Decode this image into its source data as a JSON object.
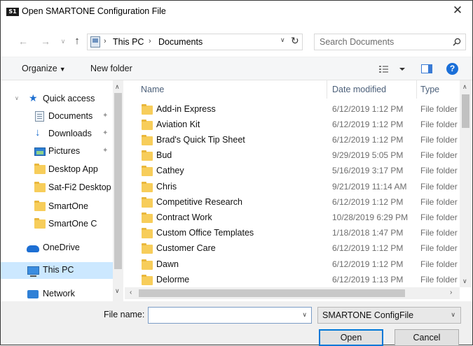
{
  "window": {
    "app_icon": "S1",
    "title": "Open SMARTONE Configuration File",
    "close_glyph": "✕"
  },
  "address": {
    "crumbs": [
      "This PC",
      "Documents"
    ],
    "search_placeholder": "Search Documents"
  },
  "toolbar": {
    "organize": "Organize",
    "new_folder": "New folder",
    "help_glyph": "?"
  },
  "navpane": {
    "items": [
      {
        "label": "Quick access",
        "icon": "star-icon",
        "pinned": false
      },
      {
        "label": "Documents",
        "icon": "document-icon",
        "pinned": true
      },
      {
        "label": "Downloads",
        "icon": "download-icon",
        "pinned": true
      },
      {
        "label": "Pictures",
        "icon": "pictures-icon",
        "pinned": true
      },
      {
        "label": "Desktop App",
        "icon": "folder-icon",
        "pinned": false
      },
      {
        "label": "Sat-Fi2 Desktop .",
        "icon": "folder-icon",
        "pinned": false
      },
      {
        "label": "SmartOne",
        "icon": "folder-icon",
        "pinned": false
      },
      {
        "label": "SmartOne C",
        "icon": "folder-icon",
        "pinned": false
      },
      {
        "label": "OneDrive",
        "icon": "onedrive-icon",
        "pinned": false
      },
      {
        "label": "This PC",
        "icon": "this-pc-icon",
        "pinned": false,
        "selected": true
      },
      {
        "label": "Network",
        "icon": "network-icon",
        "pinned": false
      }
    ]
  },
  "filelist": {
    "columns": [
      "Name",
      "Date modified",
      "Type"
    ],
    "rows": [
      {
        "name": "Add-in Express",
        "date": "6/12/2019 1:12 PM",
        "type": "File folder"
      },
      {
        "name": "Aviation Kit",
        "date": "6/12/2019 1:12 PM",
        "type": "File folder"
      },
      {
        "name": "Brad's Quick Tip Sheet",
        "date": "6/12/2019 1:12 PM",
        "type": "File folder"
      },
      {
        "name": "Bud",
        "date": "9/29/2019 5:05 PM",
        "type": "File folder"
      },
      {
        "name": "Cathey",
        "date": "5/16/2019 3:17 PM",
        "type": "File folder"
      },
      {
        "name": "Chris",
        "date": "9/21/2019 11:14 AM",
        "type": "File folder"
      },
      {
        "name": "Competitive Research",
        "date": "6/12/2019 1:12 PM",
        "type": "File folder"
      },
      {
        "name": "Contract Work",
        "date": "10/28/2019 6:29 PM",
        "type": "File folder"
      },
      {
        "name": "Custom Office Templates",
        "date": "1/18/2018 1:47 PM",
        "type": "File folder"
      },
      {
        "name": "Customer Care",
        "date": "6/12/2019 1:12 PM",
        "type": "File folder"
      },
      {
        "name": "Dawn",
        "date": "6/12/2019 1:12 PM",
        "type": "File folder"
      },
      {
        "name": "Delorme",
        "date": "6/12/2019 1:13 PM",
        "type": "File folder"
      }
    ]
  },
  "bottom": {
    "file_name_label": "File name:",
    "file_name_value": "",
    "file_type": "SMARTONE ConfigFile",
    "open_label": "Open",
    "cancel_label": "Cancel"
  }
}
